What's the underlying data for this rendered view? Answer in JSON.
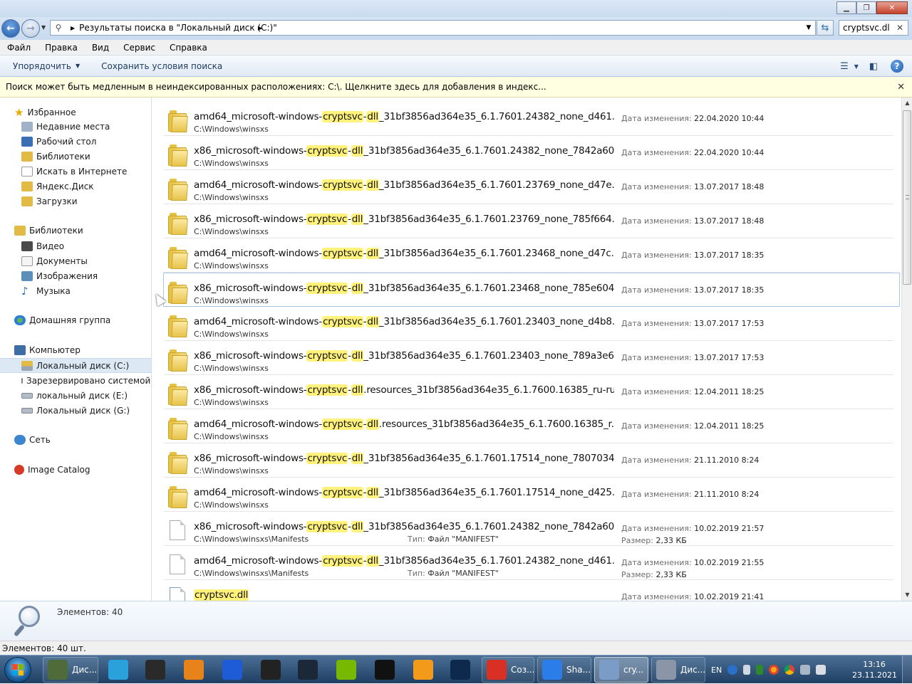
{
  "address": {
    "path": "Результаты поиска в \"Локальный диск (C:)\"",
    "search_value": "cryptsvc.dl"
  },
  "menu": [
    "Файл",
    "Правка",
    "Вид",
    "Сервис",
    "Справка"
  ],
  "toolbar": {
    "organize": "Упорядочить",
    "save_search": "Сохранить условия поиска"
  },
  "infobar": "Поиск может быть медленным в неиндексированных расположениях: C:\\. Щелкните здесь для добавления в индекс...",
  "nav": {
    "favorites": {
      "label": "Избранное",
      "items": [
        "Недавние места",
        "Рабочий стол",
        "Библиотеки",
        "Искать в Интернете",
        "Яндекс.Диск",
        "Загрузки"
      ]
    },
    "libraries": {
      "label": "Библиотеки",
      "items": [
        "Видео",
        "Документы",
        "Изображения",
        "Музыка"
      ]
    },
    "homegroup": "Домашняя группа",
    "computer": {
      "label": "Компьютер",
      "items": [
        "Локальный диск (C:)",
        "Зарезервировано системой (",
        "локальный диск  (E:)",
        "Локальный диск (G:)"
      ]
    },
    "network": "Сеть",
    "image_catalog": "Image Catalog"
  },
  "labels": {
    "date": "Дата изменения:",
    "size": "Размер:",
    "type": "Тип:"
  },
  "results": [
    {
      "icon": "folder",
      "pre": "amd64_microsoft-windows-",
      "m1": "cryptsvc",
      "mid": "-",
      "m2": "dll",
      "post": "_31bf3856ad364e35_6.1.7601.24382_none_d461...",
      "path": "C:\\Windows\\winsxs",
      "date": "22.04.2020 10:44"
    },
    {
      "icon": "folder",
      "pre": "x86_microsoft-windows-",
      "m1": "cryptsvc",
      "mid": "-",
      "m2": "dll",
      "post": "_31bf3856ad364e35_6.1.7601.24382_none_7842a60...",
      "path": "C:\\Windows\\winsxs",
      "date": "22.04.2020 10:44"
    },
    {
      "icon": "folder",
      "pre": "amd64_microsoft-windows-",
      "m1": "cryptsvc",
      "mid": "-",
      "m2": "dll",
      "post": "_31bf3856ad364e35_6.1.7601.23769_none_d47e...",
      "path": "C:\\Windows\\winsxs",
      "date": "13.07.2017 18:48"
    },
    {
      "icon": "folder",
      "pre": "x86_microsoft-windows-",
      "m1": "cryptsvc",
      "mid": "-",
      "m2": "dll",
      "post": "_31bf3856ad364e35_6.1.7601.23769_none_785f664...",
      "path": "C:\\Windows\\winsxs",
      "date": "13.07.2017 18:48"
    },
    {
      "icon": "folder",
      "pre": "amd64_microsoft-windows-",
      "m1": "cryptsvc",
      "mid": "-",
      "m2": "dll",
      "post": "_31bf3856ad364e35_6.1.7601.23468_none_d47c...",
      "path": "C:\\Windows\\winsxs",
      "date": "13.07.2017 18:35"
    },
    {
      "icon": "folder",
      "pre": "x86_microsoft-windows-",
      "m1": "cryptsvc",
      "mid": "-",
      "m2": "dll",
      "post": "_31bf3856ad364e35_6.1.7601.23468_none_785e604...",
      "path": "C:\\Windows\\winsxs",
      "date": "13.07.2017 18:35",
      "hover": true
    },
    {
      "icon": "folder",
      "pre": "amd64_microsoft-windows-",
      "m1": "cryptsvc",
      "mid": "-",
      "m2": "dll",
      "post": "_31bf3856ad364e35_6.1.7601.23403_none_d4b8...",
      "path": "C:\\Windows\\winsxs",
      "date": "13.07.2017 17:53"
    },
    {
      "icon": "folder",
      "pre": "x86_microsoft-windows-",
      "m1": "cryptsvc",
      "mid": "-",
      "m2": "dll",
      "post": "_31bf3856ad364e35_6.1.7601.23403_none_789a3e6...",
      "path": "C:\\Windows\\winsxs",
      "date": "13.07.2017 17:53"
    },
    {
      "icon": "folder",
      "pre": "x86_microsoft-windows-",
      "m1": "cryptsvc",
      "mid": "-",
      "m2": "dll",
      "post": ".resources_31bf3856ad364e35_6.1.7600.16385_ru-ru...",
      "path": "C:\\Windows\\winsxs",
      "date": "12.04.2011 18:25"
    },
    {
      "icon": "folder",
      "pre": "amd64_microsoft-windows-",
      "m1": "cryptsvc",
      "mid": "-",
      "m2": "dll",
      "post": ".resources_31bf3856ad364e35_6.1.7600.16385_r...",
      "path": "C:\\Windows\\winsxs",
      "date": "12.04.2011 18:25"
    },
    {
      "icon": "folder",
      "pre": "x86_microsoft-windows-",
      "m1": "cryptsvc",
      "mid": "-",
      "m2": "dll",
      "post": "_31bf3856ad364e35_6.1.7601.17514_none_7807034...",
      "path": "C:\\Windows\\winsxs",
      "date": "21.11.2010 8:24"
    },
    {
      "icon": "folder",
      "pre": "amd64_microsoft-windows-",
      "m1": "cryptsvc",
      "mid": "-",
      "m2": "dll",
      "post": "_31bf3856ad364e35_6.1.7601.17514_none_d425...",
      "path": "C:\\Windows\\winsxs",
      "date": "21.11.2010 8:24"
    },
    {
      "icon": "file",
      "pre": "x86_microsoft-windows-",
      "m1": "cryptsvc",
      "mid": "-",
      "m2": "dll",
      "post": "_31bf3856ad364e35_6.1.7601.24382_none_7842a60...",
      "path": "C:\\Windows\\winsxs\\Manifests",
      "date": "10.02.2019 21:57",
      "type": "Файл \"MANIFEST\"",
      "size": "2,33 КБ"
    },
    {
      "icon": "file",
      "pre": "amd64_microsoft-windows-",
      "m1": "cryptsvc",
      "mid": "-",
      "m2": "dll",
      "post": "_31bf3856ad364e35_6.1.7601.24382_none_d461...",
      "path": "C:\\Windows\\winsxs\\Manifests",
      "date": "10.02.2019 21:55",
      "type": "Файл \"MANIFEST\"",
      "size": "2,33 КБ"
    },
    {
      "icon": "dll",
      "pre": "",
      "m1": "cryptsvc.dll",
      "mid": "",
      "m2": "",
      "post": "",
      "path": "",
      "date": "10.02.2019 21:41"
    }
  ],
  "details": {
    "count": "Элементов: 40"
  },
  "status": "Элементов: 40 шт.",
  "taskbar": {
    "apps": [
      {
        "label": "Дис...",
        "color": "#4f6b3a",
        "active": false
      },
      {
        "label": "",
        "color": "#2aa1db"
      },
      {
        "label": "",
        "color": "#2a2a2a"
      },
      {
        "label": "",
        "color": "#e8831b"
      },
      {
        "label": "",
        "color": "#1e5bd6"
      },
      {
        "label": "",
        "color": "#222"
      },
      {
        "label": "",
        "color": "#1b2838"
      },
      {
        "label": "",
        "color": "#76b900"
      },
      {
        "label": "",
        "color": "#111"
      },
      {
        "label": "",
        "color": "#f49a1a"
      },
      {
        "label": "",
        "color": "#0d2a4d"
      },
      {
        "label": "Соз...",
        "color": "#d93025"
      },
      {
        "label": "Sha...",
        "color": "#2b7de9"
      },
      {
        "label": "cry...",
        "color": "#7a9cc6",
        "active": true
      },
      {
        "label": "Дис...",
        "color": "#8a96a8"
      }
    ],
    "lang": "EN",
    "time": "13:16",
    "date": "23.11.2021"
  },
  "colors": {
    "highlight": "#fff27a",
    "selection": "#dde8f5",
    "infobar": "#ffffe1"
  }
}
